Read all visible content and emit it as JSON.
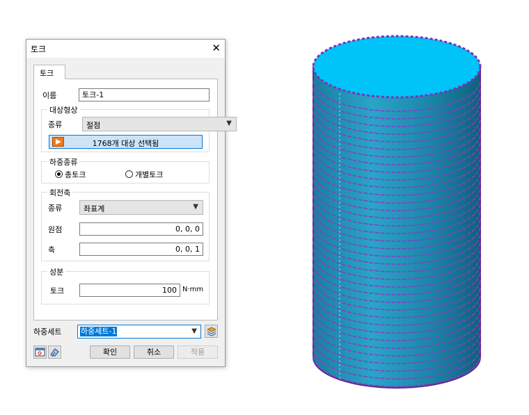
{
  "dialog": {
    "title": "토크",
    "close_icon": "close-icon",
    "tab_label": "토크",
    "name_label": "이름",
    "name_value": "토크-1",
    "target_group": {
      "title": "대상형상",
      "type_label": "종류",
      "type_value": "절점",
      "select_button_label": "1768개 대상 선택됨",
      "select_icon": "arrow-select-icon"
    },
    "load_type_group": {
      "title": "하중종류",
      "options": [
        "총토크",
        "개별토크"
      ],
      "selected": "총토크"
    },
    "axis_group": {
      "title": "회전축",
      "type_label": "종류",
      "type_value": "좌표계",
      "origin_label": "원점",
      "origin_value": "0, 0, 0",
      "axis_label": "축",
      "axis_value": "0, 0, 1"
    },
    "component_group": {
      "title": "성분",
      "torque_label": "토크",
      "torque_value": "100",
      "torque_unit": "N·mm"
    },
    "load_set_label": "하중세트",
    "load_set_value": "하중세트-1",
    "buttons": {
      "ok": "확인",
      "cancel": "취소",
      "apply": "적용"
    }
  },
  "colors": {
    "cylinder_top": "#00c3f8",
    "cylinder_side": "#1e8fb0",
    "arrows": "#8a3cc4",
    "accent": "#0078d7"
  }
}
